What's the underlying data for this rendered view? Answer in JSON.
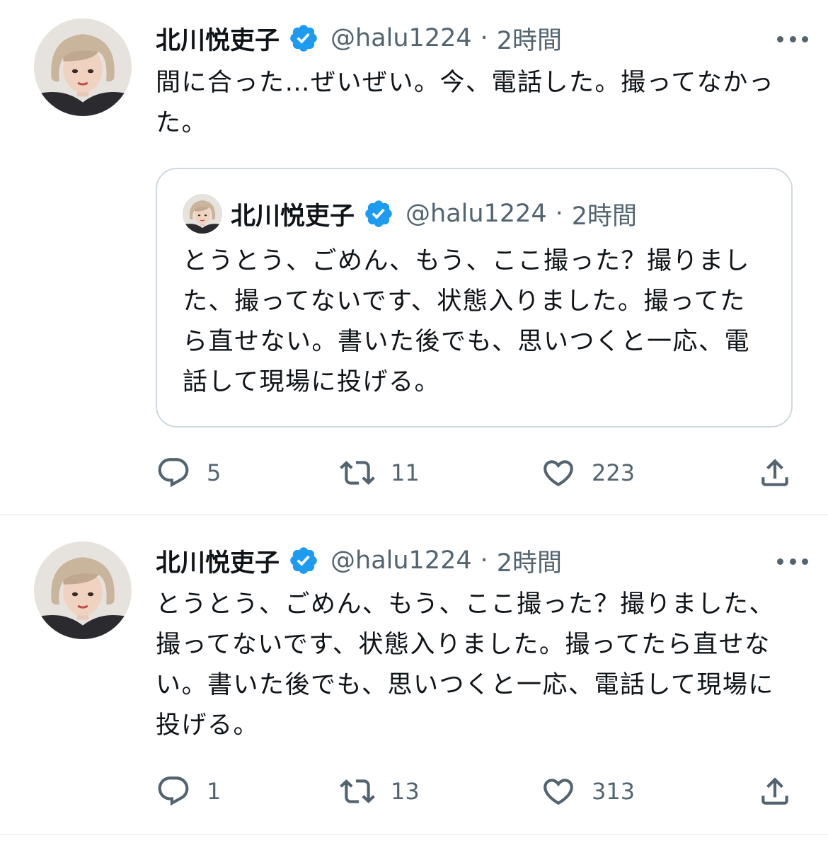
{
  "tweets": [
    {
      "author": {
        "name": "北川悦吏子",
        "handle": "@halu1224",
        "separator": "·",
        "time": "2時間"
      },
      "text": "間に合った…ぜいぜい。今、電話した。撮ってなかった。",
      "quote": {
        "author": {
          "name": "北川悦吏子",
          "handle": "@halu1224",
          "separator": "·",
          "time": "2時間"
        },
        "text": "とうとう、ごめん、もう、ここ撮った？撮りました、撮ってないです、状態入りました。撮ってたら直せない。書いた後でも、思いつくと一応、電話して現場に投げる。"
      },
      "actions": {
        "replies": "5",
        "retweets": "11",
        "likes": "223"
      }
    },
    {
      "author": {
        "name": "北川悦吏子",
        "handle": "@halu1224",
        "separator": "·",
        "time": "2時間"
      },
      "text": "とうとう、ごめん、もう、ここ撮った？撮りました、撮ってないです、状態入りました。撮ってたら直せない。書いた後でも、思いつくと一応、電話して現場に投げる。",
      "actions": {
        "replies": "1",
        "retweets": "13",
        "likes": "313"
      }
    }
  ],
  "colors": {
    "text_primary": "#0f1419",
    "text_secondary": "#536471",
    "verified_blue": "#1d9bf0",
    "border": "#cfd9de",
    "divider": "#eff3f4"
  },
  "icons": {
    "verified": "verified-badge-icon",
    "more": "more-horizontal-icon",
    "reply": "reply-icon",
    "retweet": "retweet-icon",
    "like": "heart-icon",
    "share": "share-icon"
  }
}
